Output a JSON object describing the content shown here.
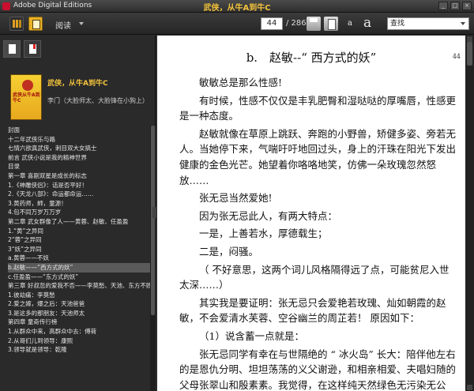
{
  "window": {
    "app_title": "Adobe Digital Editions",
    "book_title": "武侠，从牛A到牛C"
  },
  "toolbar": {
    "mode": "阅读",
    "page_current": "44",
    "page_total": "/ 286",
    "font_small": "a",
    "font_large": "a",
    "search_placeholder": "查找"
  },
  "sidebar": {
    "cover_text": "武侠从牛A到牛C",
    "book_title": "武侠，从牛A到牛C",
    "author": "李门（大脸师太、大脸锋在小狗上）",
    "toc": [
      "封面",
      "十二年武侠乐与路",
      "七情六欲真武侠，刺目双大女搞士",
      "前言 武侠小说是我的精神世界",
      "目录",
      "第一章 喜剧双星是成长的标志",
      "1.《神雕侠侣》：话是否平好！",
      "2.《天龙八部》：命运都命运……",
      "3.黄药师，師，童源！",
      "4.包不同万岁万万岁",
      "第二章 武女群像了人——黄蓉、赵敏、任盈盈",
      "1.“黄”之异同",
      "2“蓉”之异同",
      "3“妖”之异同",
      "a.黄蓉——不妖",
      "b.赵敏——“西方式的妖”",
      "c.任盈盈——“东方式的妖”",
      "第三章 好叔忽的爱我不否——李莫愁、天池、东方不败",
      "1.彼劫痛：李莫愁",
      "2.爱之嫁，爆之后：天池爸爸",
      "3.是这多的那朋友：天池师太",
      "第四章 童奇传行榜",
      "1.从群众中来，高群众中去：傅荷",
      "2.从哥们儿到领导：康熙",
      "3.领导就是领导：乾隆"
    ],
    "selected_toc": 15
  },
  "content": {
    "page_number": "44",
    "chapter_title": "b.　赵敏--“ 西方式的妖”",
    "paragraphs": [
      "敏敏总是那么性感!",
      "有时候，性感不仅仅是丰乳肥臀和湿哒哒的厚嘴唇，性感更是一种态度。",
      "赵敏就像在草原上跳跃、奔跑的小野兽，矫健多姿、旁若无人。当她停下来，气喘吁吁地回过头，身上的汗珠在阳光下发出健康的金色光芒。她望着你咯咯地笑，仿佛一朵玫瑰忽然怒放……",
      "张无忌当然爱她!",
      "因为张无忌此人，有两大特点：",
      "一是，上善若水，厚德载生；",
      "二是，闷骚。",
      "（ 不好意思，这两个词儿风格隔得远了点，可能贫尼入世太深……）",
      "其实我是要证明：张无忌只会爱艳若玫瑰、灿如朝霞的赵敏，不会爱清水芙蓉、空谷幽兰的周芷若！ 原因如下：",
      "（1）说含蓄一点就是：",
      "张无忌同学有幸在与世隔绝的 “ 冰火岛” 长大：陪伴他左右的是恩仇分明、坦坦荡荡的义父谢逊，和相亲相爱、夫唱妇随的父母张翠山和殷素素。我觉得，在这样纯天然绿色无污染无公"
    ]
  }
}
